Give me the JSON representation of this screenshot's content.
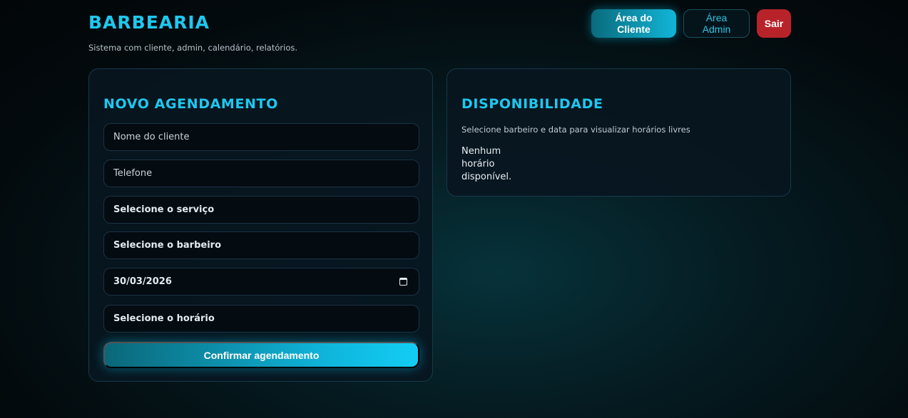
{
  "header": {
    "title": "BARBEARIA",
    "subtitle": "Sistema com cliente, admin, calendário, relatórios."
  },
  "nav": {
    "client_area": "Área do Cliente",
    "admin_area": "Área Admin",
    "logout": "Sair"
  },
  "form": {
    "title": "NOVO AGENDAMENTO",
    "client_name_placeholder": "Nome do cliente",
    "phone_placeholder": "Telefone",
    "service_select": "Selecione o serviço",
    "barber_select": "Selecione o barbeiro",
    "date_value": "30/03/2026",
    "time_select": "Selecione o horário",
    "confirm_label": "Confirmar agendamento"
  },
  "availability": {
    "title": "DISPONIBILIDADE",
    "hint": "Selecione barbeiro e data para visualizar horários livres",
    "empty": "Nenhum horário disponível."
  },
  "colors": {
    "accent": "#1ec8f0",
    "danger": "#b8232a",
    "background": "#030a0d"
  }
}
